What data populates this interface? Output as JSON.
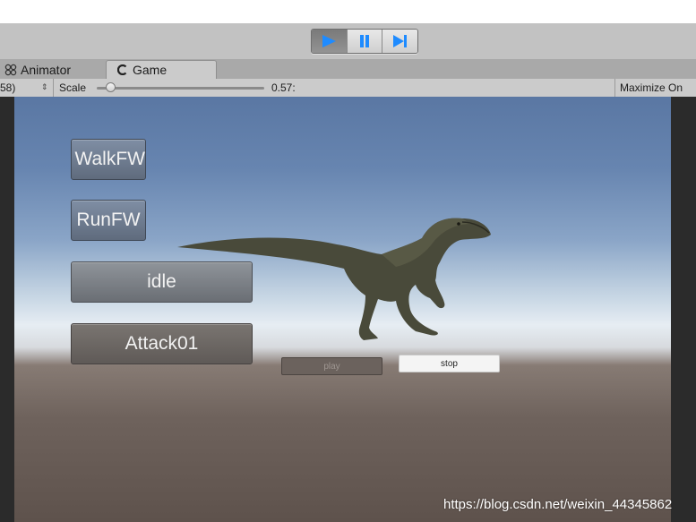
{
  "toolbar": {
    "play_icon": "play-icon",
    "pause_icon": "pause-icon",
    "step_icon": "step-icon",
    "accent_color": "#1e8bff"
  },
  "tabs": [
    {
      "label": "Animator",
      "icon": "animator-icon"
    },
    {
      "label": "Game",
      "icon": "game-icon"
    }
  ],
  "gamebar": {
    "resolution_partial": "58)",
    "scale_label": "Scale",
    "scale_value": "0.57:",
    "maximize_label": "Maximize On"
  },
  "game": {
    "buttons": {
      "walk": "WalkFW",
      "run": "RunFW",
      "idle": "idle",
      "attack": "Attack01",
      "play": "play",
      "stop": "stop"
    }
  },
  "watermark": "https://blog.csdn.net/weixin_44345862"
}
